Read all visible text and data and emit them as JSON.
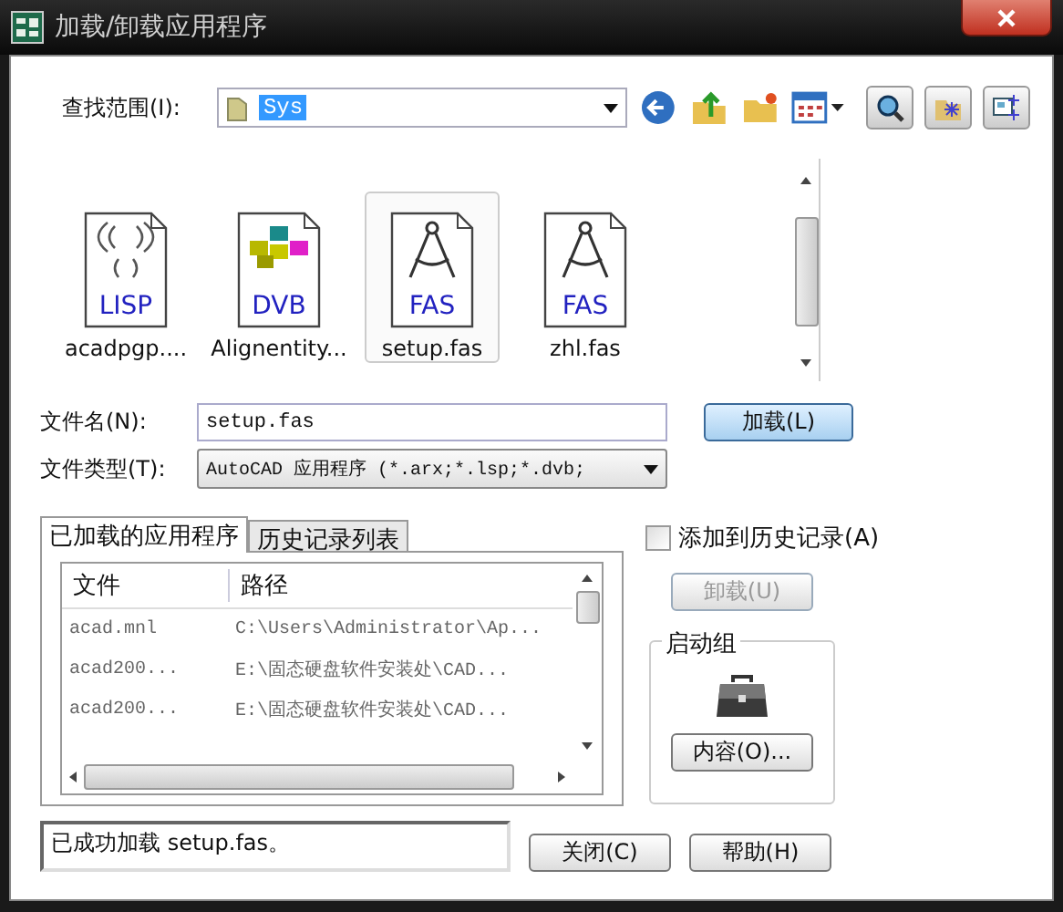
{
  "window": {
    "title": "加载/卸载应用程序"
  },
  "look_in": {
    "label": "查找范围(I):",
    "value": "Sys"
  },
  "files": [
    {
      "name": "acadpgp....",
      "kind": "lisp",
      "badge": "LISP",
      "selected": false
    },
    {
      "name": "Alignentity...",
      "kind": "dvb",
      "badge": "DVB",
      "selected": false
    },
    {
      "name": "setup.fas",
      "kind": "fas",
      "badge": "FAS",
      "selected": true
    },
    {
      "name": "zhl.fas",
      "kind": "fas",
      "badge": "FAS",
      "selected": false
    }
  ],
  "file_name": {
    "label": "文件名(N):",
    "value": "setup.fas"
  },
  "file_type": {
    "label": "文件类型(T):",
    "value": "AutoCAD 应用程序 (*.arx;*.lsp;*.dvb;"
  },
  "load_button": "加载(L)",
  "tabs": [
    {
      "label": "已加载的应用程序",
      "selected": true
    },
    {
      "label": "历史记录列表",
      "selected": false
    }
  ],
  "table": {
    "columns": [
      "文件",
      "路径"
    ],
    "rows": [
      [
        "acad.mnl",
        "C:\\Users\\Administrator\\Ap..."
      ],
      [
        "acad200...",
        "E:\\固态硬盘软件安装处\\CAD..."
      ],
      [
        "acad200...",
        "E:\\固态硬盘软件安装处\\CAD..."
      ]
    ]
  },
  "add_to_history": {
    "label": "添加到历史记录(A)",
    "checked": false
  },
  "unload_button": {
    "label": "卸载(U)",
    "disabled": true
  },
  "startup_group": {
    "title": "启动组",
    "button": "内容(O)..."
  },
  "status": "已成功加载 setup.fas。",
  "buttons": [
    "关闭(C)",
    "帮助(H)"
  ]
}
